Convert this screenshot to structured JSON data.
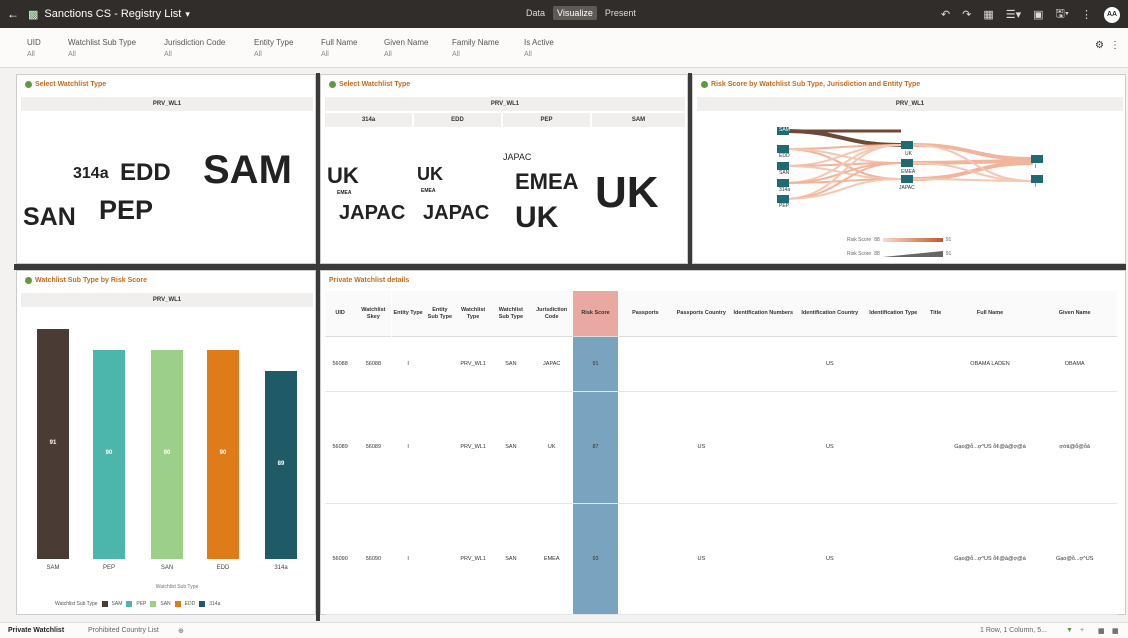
{
  "topbar": {
    "back_icon": "arrow-left-icon",
    "title": "Sanctions CS - Registry List",
    "modes": [
      "Data",
      "Visualize",
      "Present"
    ],
    "active_mode": "Visualize",
    "avatar": "AA"
  },
  "filters": [
    {
      "label": "UID",
      "value": "All"
    },
    {
      "label": "Watchlist Sub Type",
      "value": "All"
    },
    {
      "label": "Jurisdiction Code",
      "value": "All"
    },
    {
      "label": "Entity Type",
      "value": "All"
    },
    {
      "label": "Full Name",
      "value": "All"
    },
    {
      "label": "Given Name",
      "value": "All"
    },
    {
      "label": "Family Name",
      "value": "All"
    },
    {
      "label": "Is Active",
      "value": "All"
    }
  ],
  "panel1": {
    "title": "Select Watchlist Type",
    "header": "PRV_WL1",
    "words": [
      {
        "text": "SAM",
        "color": "#4a3c35"
      },
      {
        "text": "EDD",
        "color": "#e07b1a"
      },
      {
        "text": "314a",
        "color": "#1f5b66"
      },
      {
        "text": "PEP",
        "color": "#4db6ac"
      },
      {
        "text": "SAN",
        "color": "#9ccf8a"
      }
    ]
  },
  "panel2": {
    "title": "Select Watchlist Type",
    "header": "PRV_WL1",
    "columns": [
      "314a",
      "EDD",
      "PEP",
      "SAM"
    ],
    "words": [
      {
        "text": "UK",
        "color": "#9ccf8a"
      },
      {
        "text": "EMEA",
        "color": "#4db6ac"
      },
      {
        "text": "JAPAC",
        "color": "#3a3532"
      },
      {
        "text": "UK",
        "color": "#9ccf8a"
      },
      {
        "text": "EMEA",
        "color": "#4db6ac"
      },
      {
        "text": "JAPAC",
        "color": "#3a3532"
      },
      {
        "text": "JAPAC",
        "color": "#3a3532"
      },
      {
        "text": "EMEA",
        "color": "#4db6ac"
      },
      {
        "text": "UK",
        "color": "#9ccf8a"
      },
      {
        "text": "UK",
        "color": "#9ccf8a"
      }
    ]
  },
  "panel3": {
    "title": "Risk Score by Watchlist Sub Type, Jurisdiction and Entity Type",
    "header": "PRV_WL1",
    "left_nodes": [
      "SAM",
      "EDD",
      "SAN",
      "314a",
      "PEP"
    ],
    "middle_nodes": [
      "UK",
      "EMEA",
      "JAPAC"
    ],
    "right_nodes": [
      "I",
      "I"
    ],
    "legend": [
      {
        "label": "Risk Score",
        "min": "88",
        "max": "91"
      },
      {
        "label": "Risk Score",
        "min": "88",
        "max": "91"
      }
    ]
  },
  "panel4": {
    "title": "Watchlist Sub Type by Risk Score",
    "header": "PRV_WL1",
    "xlabel": "Watchlist Sub Type",
    "legend_title": "Watchlist Sub Type",
    "colors": {
      "SAM": "#4a3c35",
      "PEP": "#4db6ac",
      "SAN": "#9ccf8a",
      "EDD": "#e07b1a",
      "314a": "#1f5b66"
    }
  },
  "chart_data": {
    "type": "bar",
    "title": "Watchlist Sub Type by Risk Score",
    "categories": [
      "SAM",
      "PEP",
      "SAN",
      "EDD",
      "314a"
    ],
    "values": [
      91,
      90,
      90,
      90,
      89
    ],
    "xlabel": "Watchlist Sub Type",
    "ylabel": "",
    "ylim": [
      0,
      91
    ]
  },
  "panel5": {
    "title": "Private Watchlist details",
    "columns": [
      "UID",
      "Watchlist Skey",
      "Entity Type",
      "Entity Sub Type",
      "Watchlist Type",
      "Watchlist Sub Type",
      "Jurisdiction Code",
      "Risk Score",
      "Passports",
      "Passports Country",
      "Identification Numbers",
      "Identification Country",
      "Identification Type",
      "Title",
      "Full Name",
      "Given Name"
    ],
    "rows": [
      [
        "56088",
        "56088",
        "I",
        "",
        "PRV_WL1",
        "SAN",
        "JAPAC",
        "91",
        "",
        "",
        "",
        "US",
        "",
        "",
        "OBAMA LADEN",
        "OBAMA"
      ],
      [
        "56089",
        "56089",
        "I",
        "",
        "PRV_WL1",
        "SAN",
        "UK",
        "87",
        "",
        "US",
        "",
        "US",
        "",
        "",
        "Gạo@ỗ...ợ^US ỗ¢@ả@ợ@à",
        "ợờả@ỗ@ỗả"
      ],
      [
        "56090",
        "56090",
        "I",
        "",
        "PRV_WL1",
        "SAN",
        "EMEA",
        "93",
        "",
        "US",
        "",
        "US",
        "",
        "",
        "Gạo@ỗ...ợ^US ỗ¢@ả@ợ@à",
        "Gạo@ỗ...ợ^US"
      ]
    ]
  },
  "bottom": {
    "tabs": [
      "Private Watchlist",
      "Prohibited Country List"
    ],
    "status": "1 Row, 1 Column, 5..."
  }
}
